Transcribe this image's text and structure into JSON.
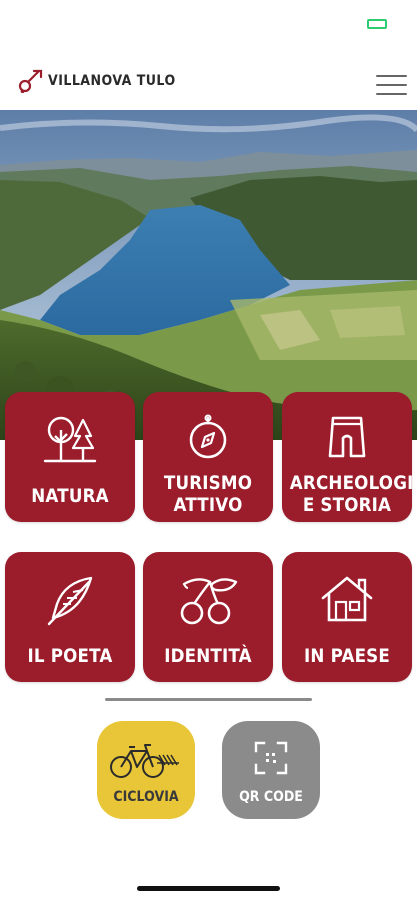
{
  "app": {
    "name": "VILLANOVA TULO"
  },
  "colors": {
    "tile_bg": "#9b1c2b",
    "ciclovia_bg": "#e8c637",
    "qrcode_bg": "#8b8b8b",
    "battery": "#2ecc71"
  },
  "tiles": [
    {
      "label_lines": [
        "NATURA"
      ],
      "icon": "trees-icon"
    },
    {
      "label_lines": [
        "TURISMO",
        "ATTIVO"
      ],
      "icon": "compass-icon"
    },
    {
      "label_lines": [
        "ARCHEOLOGIA",
        "E STORIA"
      ],
      "icon": "nuraghe-icon"
    },
    {
      "label_lines": [
        "IL POETA"
      ],
      "icon": "feather-icon"
    },
    {
      "label_lines": [
        "IDENTITÀ"
      ],
      "icon": "cherries-icon"
    },
    {
      "label_lines": [
        "IN PAESE"
      ],
      "icon": "house-icon"
    }
  ],
  "bottom_buttons": {
    "ciclovia": {
      "label": "CICLOVIA",
      "icon": "bicycle-icon"
    },
    "qrcode": {
      "label": "QR CODE",
      "icon": "qr-scan-icon"
    }
  }
}
